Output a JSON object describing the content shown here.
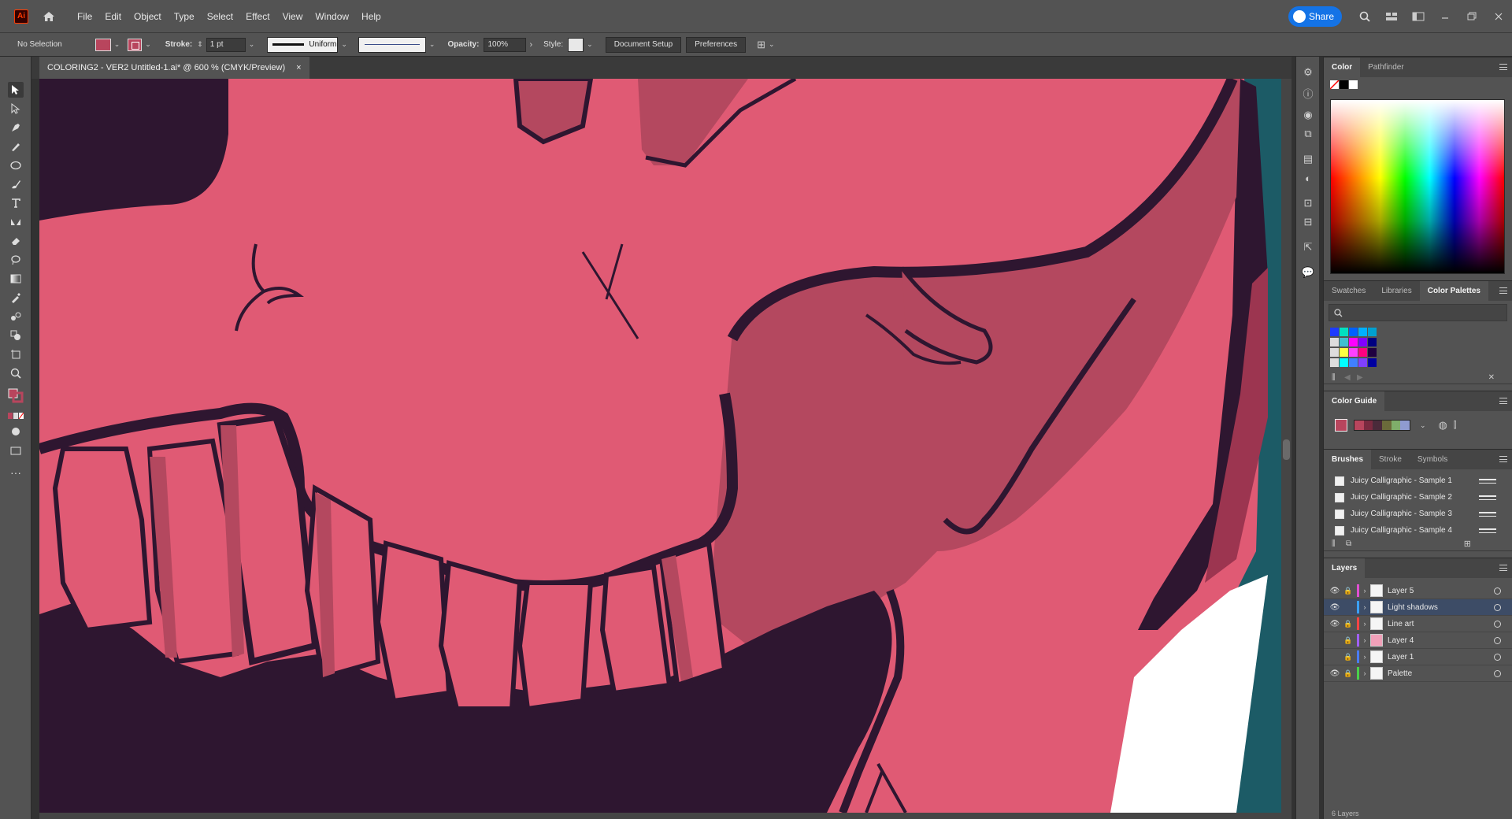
{
  "app": {
    "logo": "Ai"
  },
  "menu": [
    "File",
    "Edit",
    "Object",
    "Type",
    "Select",
    "Effect",
    "View",
    "Window",
    "Help"
  ],
  "header": {
    "share_label": "Share"
  },
  "control": {
    "selection_label": "No Selection",
    "stroke_label": "Stroke:",
    "stroke_weight": "1 pt",
    "profile_label": "Uniform",
    "opacity_label": "Opacity:",
    "opacity_value": "100%",
    "style_label": "Style:",
    "document_setup": "Document Setup",
    "preferences": "Preferences"
  },
  "document": {
    "tab_title": "COLORING2 - VER2 Untitled-1.ai* @ 600 % (CMYK/Preview)",
    "close": "×"
  },
  "colors": {
    "canvas_pink": "#e05a74",
    "shadow_pink": "#b4485f",
    "dark_purple": "#2e1630",
    "teal": "#1c5b66",
    "fill_swatch": "#b8455d"
  },
  "color_panel": {
    "tabs": [
      "Color",
      "Pathfinder"
    ]
  },
  "swatches_panel": {
    "tabs": [
      "Swatches",
      "Libraries",
      "Color Palettes"
    ],
    "active": "Color Palettes"
  },
  "color_guide": {
    "title": "Color Guide",
    "colors": [
      "#b8455d",
      "#7a2a40",
      "#4a2a3a",
      "#6b6a3a",
      "#7fae6a",
      "#8f9bd0"
    ]
  },
  "brushes_panel": {
    "tabs": [
      "Brushes",
      "Stroke",
      "Symbols"
    ],
    "items": [
      "Juicy Calligraphic - Sample 1",
      "Juicy Calligraphic - Sample 2",
      "Juicy Calligraphic - Sample 3",
      "Juicy Calligraphic - Sample 4"
    ]
  },
  "layers_panel": {
    "title": "Layers",
    "layers": [
      {
        "name": "Layer 5",
        "color": "#e04fd1",
        "visible": true,
        "locked": true
      },
      {
        "name": "Light shadows",
        "color": "#3aa0ff",
        "visible": true,
        "locked": false
      },
      {
        "name": "Line art",
        "color": "#ff4444",
        "visible": true,
        "locked": true
      },
      {
        "name": "Layer 4",
        "color": "#a060ff",
        "visible": false,
        "locked": true
      },
      {
        "name": "Layer 1",
        "color": "#4a7bff",
        "visible": false,
        "locked": true
      },
      {
        "name": "Palette",
        "color": "#4ad04a",
        "visible": true,
        "locked": true
      }
    ],
    "footer": "6 Layers"
  },
  "icons": [
    "home-icon",
    "search-icon",
    "arrange-icon",
    "minimize-icon",
    "maximize-icon",
    "close-icon",
    "selection-tool-icon",
    "direct-selection-icon",
    "pen-icon",
    "pencil-icon",
    "ellipse-icon",
    "brush-icon",
    "type-icon",
    "reflect-icon",
    "eraser-icon",
    "lasso-icon",
    "gradient-icon",
    "eyedropper-icon",
    "blend-icon",
    "shape-builder-icon",
    "artboard-icon",
    "zoom-icon",
    "swap-icon",
    "more-icon",
    "gear-icon",
    "info-icon",
    "layers-icon"
  ]
}
